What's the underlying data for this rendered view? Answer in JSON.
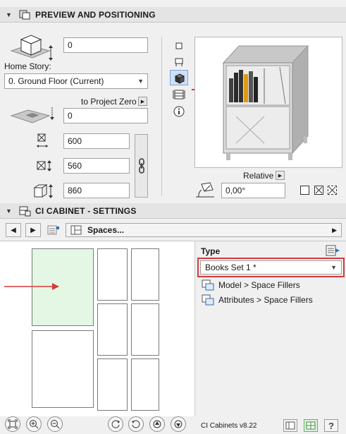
{
  "preview_section": {
    "title": "PREVIEW AND POSITIONING",
    "elevation_value": "0",
    "home_story_label": "Home Story:",
    "home_story_value": "0. Ground Floor (Current)",
    "to_project_zero_label": "to Project Zero",
    "offset_value": "0",
    "width_value": "600",
    "depth_value": "560",
    "height_value": "860",
    "relative_label": "Relative",
    "angle_value": "0,00°"
  },
  "settings_section": {
    "title": "CI CABINET - SETTINGS",
    "path_label": "Spaces..."
  },
  "type_panel": {
    "type_label": "Type",
    "type_value": "Books Set 1 *",
    "link_model": "Model > Space Fillers",
    "link_attributes": "Attributes > Space Fillers"
  },
  "footer": {
    "version": "CI Cabinets v8.22"
  },
  "colors": {
    "highlight_red": "#d9383a",
    "selected_cell": "#e4f7e4",
    "accent_blue": "#2f6fb3"
  }
}
